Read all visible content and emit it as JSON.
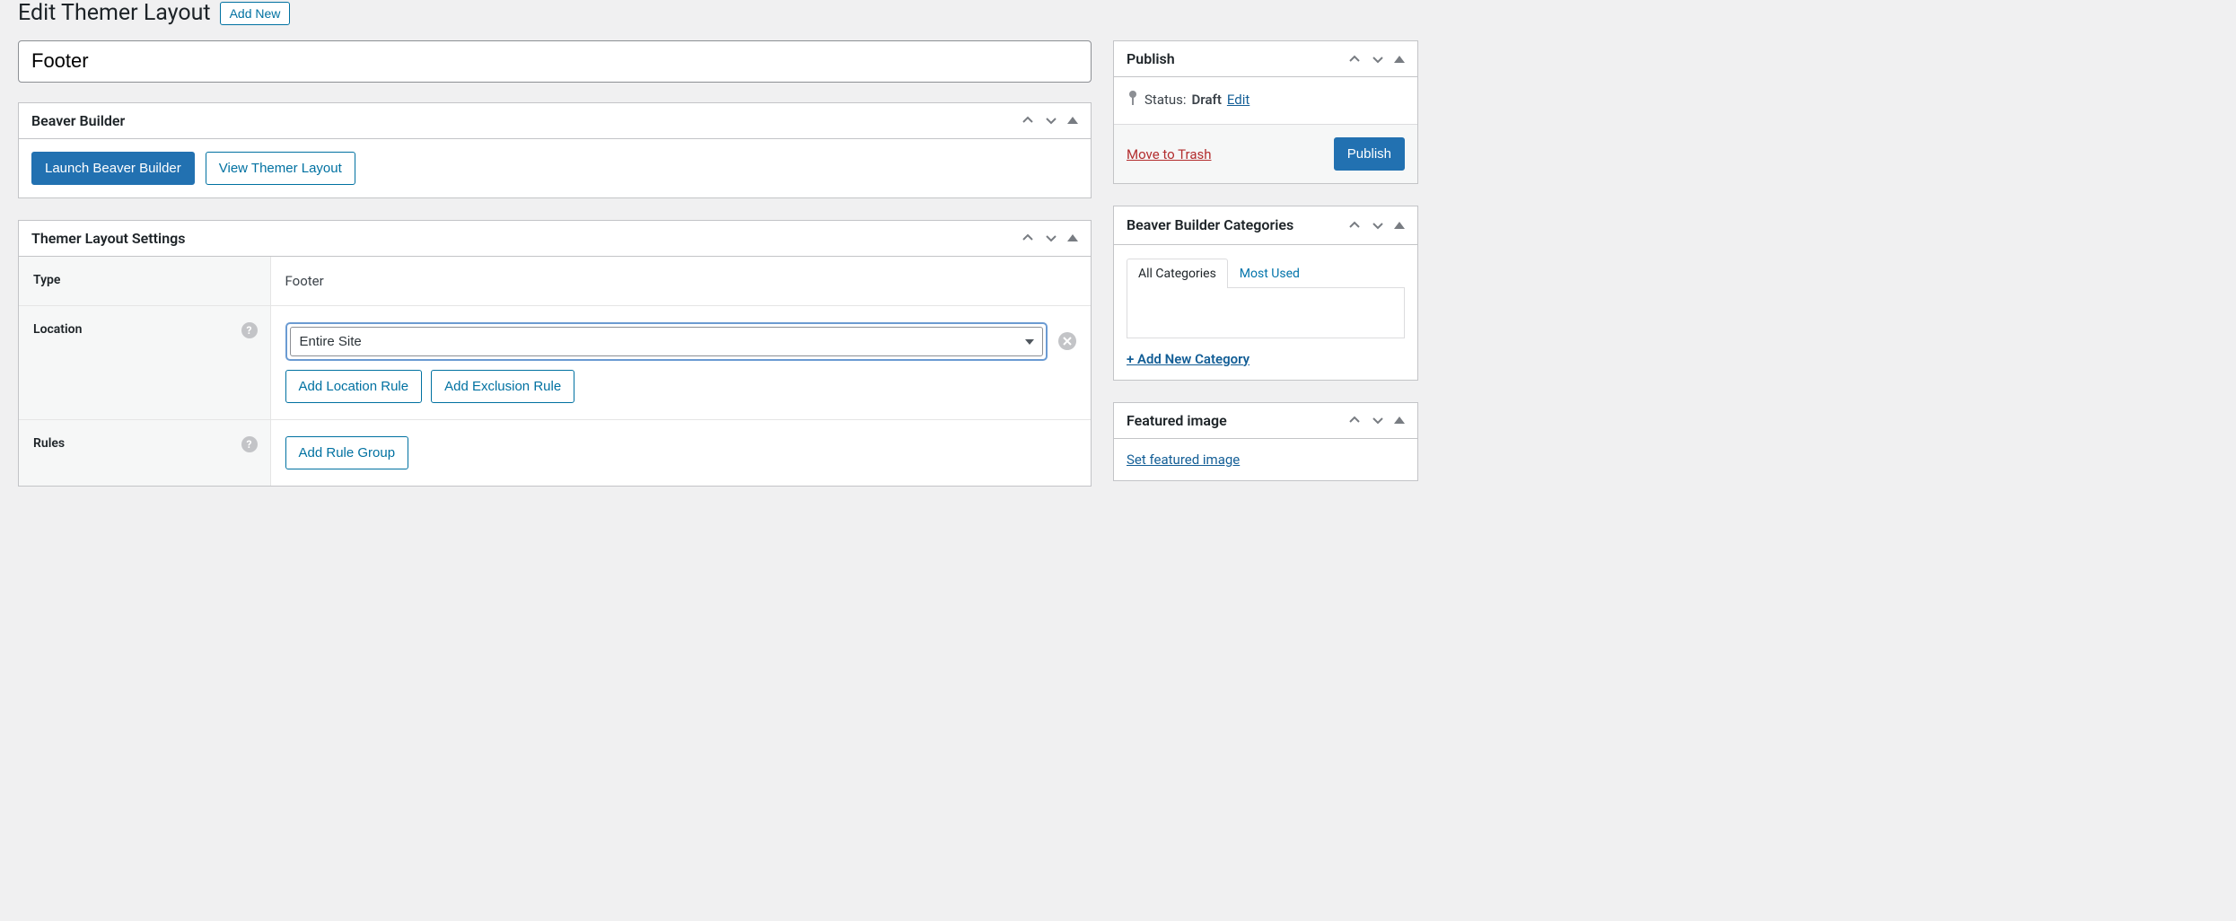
{
  "header": {
    "page_title": "Edit Themer Layout",
    "add_new_label": "Add New"
  },
  "title_input": {
    "value": "Footer"
  },
  "beaver_builder_box": {
    "title": "Beaver Builder",
    "launch_label": "Launch Beaver Builder",
    "view_label": "View Themer Layout"
  },
  "settings_box": {
    "title": "Themer Layout Settings",
    "rows": {
      "type": {
        "label": "Type",
        "value": "Footer"
      },
      "location": {
        "label": "Location",
        "select_value": "Entire Site",
        "add_location_label": "Add Location Rule",
        "add_exclusion_label": "Add Exclusion Rule"
      },
      "rules": {
        "label": "Rules",
        "add_rule_group_label": "Add Rule Group"
      }
    }
  },
  "publish_box": {
    "title": "Publish",
    "status_label": "Status:",
    "status_value": "Draft",
    "edit_label": "Edit",
    "trash_label": "Move to Trash",
    "publish_label": "Publish"
  },
  "categories_box": {
    "title": "Beaver Builder Categories",
    "tab_all": "All Categories",
    "tab_most": "Most Used",
    "add_new_category": "+ Add New Category"
  },
  "featured_box": {
    "title": "Featured image",
    "set_label": "Set featured image"
  }
}
